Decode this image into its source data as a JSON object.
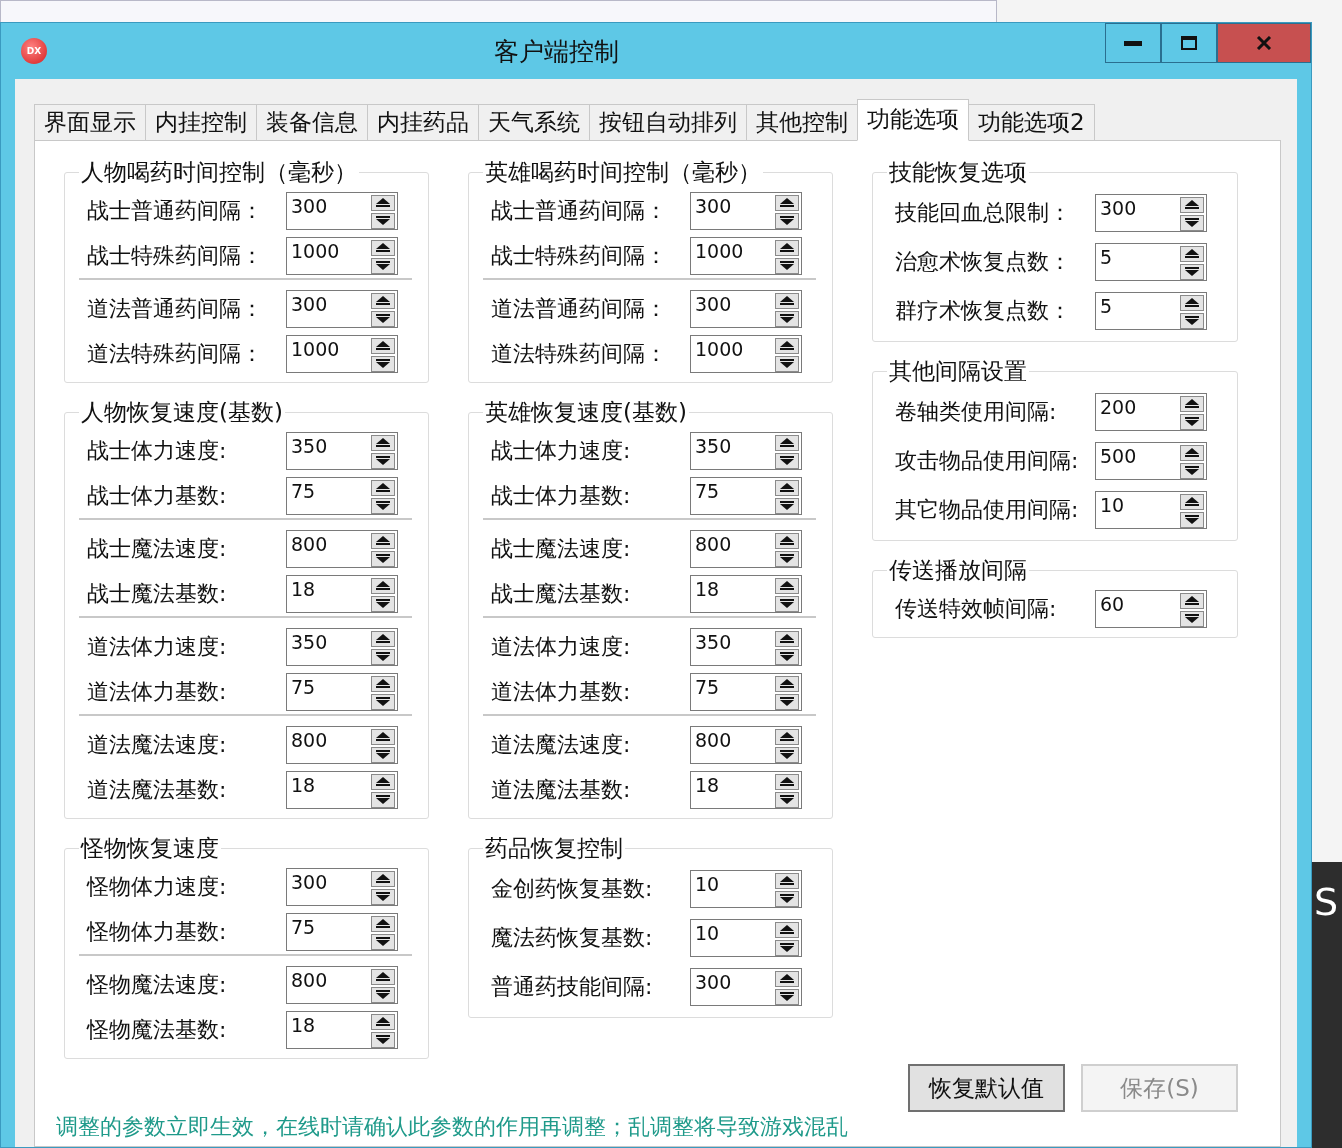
{
  "window": {
    "app_icon": "DX",
    "title": "客户端控制"
  },
  "tabs": [
    {
      "label": "界面显示",
      "selected": false
    },
    {
      "label": "内挂控制",
      "selected": false
    },
    {
      "label": "装备信息",
      "selected": false
    },
    {
      "label": "内挂药品",
      "selected": false
    },
    {
      "label": "天气系统",
      "selected": false
    },
    {
      "label": "按钮自动排列",
      "selected": false
    },
    {
      "label": "其他控制",
      "selected": false
    },
    {
      "label": "功能选项",
      "selected": true
    },
    {
      "label": "功能选项2",
      "selected": false
    }
  ],
  "columns": [
    {
      "groups": [
        {
          "title": "人物喝药时间控制（毫秒）",
          "sections": [
            [
              {
                "label": "战士普通药间隔：",
                "value": "300"
              },
              {
                "label": "战士特殊药间隔：",
                "value": "1000"
              }
            ],
            [
              {
                "label": "道法普通药间隔：",
                "value": "300"
              },
              {
                "label": "道法特殊药间隔：",
                "value": "1000"
              }
            ]
          ]
        },
        {
          "title": "人物恢复速度(基数)",
          "sections": [
            [
              {
                "label": "战士体力速度:",
                "value": "350"
              },
              {
                "label": "战士体力基数:",
                "value": "75"
              }
            ],
            [
              {
                "label": "战士魔法速度:",
                "value": "800"
              },
              {
                "label": "战士魔法基数:",
                "value": "18"
              }
            ],
            [
              {
                "label": "道法体力速度:",
                "value": "350"
              },
              {
                "label": "道法体力基数:",
                "value": "75"
              }
            ],
            [
              {
                "label": "道法魔法速度:",
                "value": "800"
              },
              {
                "label": "道法魔法基数:",
                "value": "18"
              }
            ]
          ]
        },
        {
          "title": "怪物恢复速度",
          "sections": [
            [
              {
                "label": "怪物体力速度:",
                "value": "300"
              },
              {
                "label": "怪物体力基数:",
                "value": "75"
              }
            ],
            [
              {
                "label": "怪物魔法速度:",
                "value": "800"
              },
              {
                "label": "怪物魔法基数:",
                "value": "18"
              }
            ]
          ]
        }
      ]
    },
    {
      "groups": [
        {
          "title": "英雄喝药时间控制（毫秒）",
          "sections": [
            [
              {
                "label": "战士普通药间隔：",
                "value": "300"
              },
              {
                "label": "战士特殊药间隔：",
                "value": "1000"
              }
            ],
            [
              {
                "label": "道法普通药间隔：",
                "value": "300"
              },
              {
                "label": "道法特殊药间隔：",
                "value": "1000"
              }
            ]
          ]
        },
        {
          "title": "英雄恢复速度(基数)",
          "sections": [
            [
              {
                "label": "战士体力速度:",
                "value": "350"
              },
              {
                "label": "战士体力基数:",
                "value": "75"
              }
            ],
            [
              {
                "label": "战士魔法速度:",
                "value": "800"
              },
              {
                "label": "战士魔法基数:",
                "value": "18"
              }
            ],
            [
              {
                "label": "道法体力速度:",
                "value": "350"
              },
              {
                "label": "道法体力基数:",
                "value": "75"
              }
            ],
            [
              {
                "label": "道法魔法速度:",
                "value": "800"
              },
              {
                "label": "道法魔法基数:",
                "value": "18"
              }
            ]
          ]
        },
        {
          "title": "药品恢复控制",
          "sections": [
            [
              {
                "label": "金创药恢复基数:",
                "value": "10"
              },
              {
                "label": "魔法药恢复基数:",
                "value": "10"
              },
              {
                "label": "普通药技能间隔:",
                "value": "300"
              }
            ]
          ]
        }
      ]
    },
    {
      "groups": [
        {
          "title": "技能恢复选项",
          "sections": [
            [
              {
                "label": "技能回血总限制：",
                "value": "300"
              },
              {
                "label": "治愈术恢复点数：",
                "value": "5"
              },
              {
                "label": "群疗术恢复点数：",
                "value": "5"
              }
            ]
          ]
        },
        {
          "title": "其他间隔设置",
          "sections": [
            [
              {
                "label": "卷轴类使用间隔:",
                "value": "200"
              },
              {
                "label": "攻击物品使用间隔:",
                "value": "500"
              },
              {
                "label": "其它物品使用间隔:",
                "value": "10"
              }
            ]
          ]
        },
        {
          "title": "传送播放间隔",
          "sections": [
            [
              {
                "label": "传送特效帧间隔:",
                "value": "60"
              }
            ]
          ]
        }
      ]
    }
  ],
  "buttons": [
    {
      "label": "恢复默认值",
      "disabled": false
    },
    {
      "label": "保存(S)",
      "disabled": true
    }
  ],
  "note": "调整的参数立即生效，在线时请确认此参数的作用再调整；乱调整将导致游戏混乱",
  "background": {
    "letter": "S"
  }
}
